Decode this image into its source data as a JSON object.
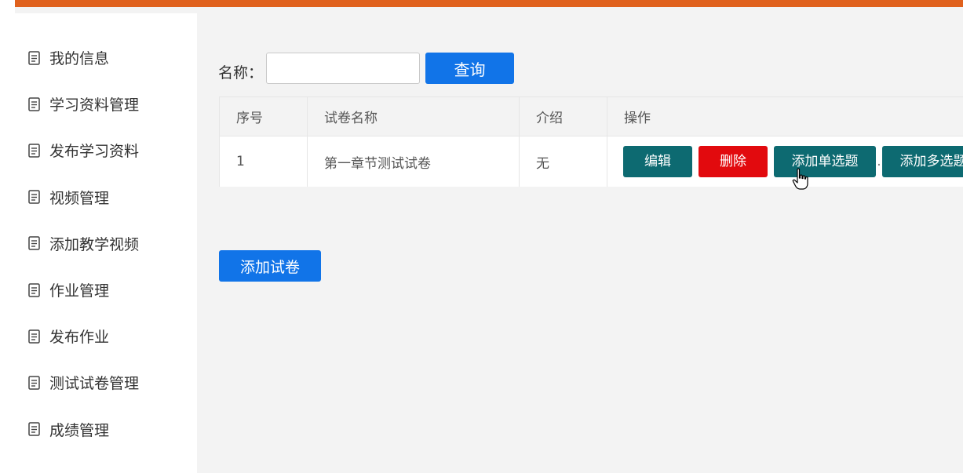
{
  "sidebar": {
    "items": [
      {
        "label": "我的信息",
        "icon": "document-icon"
      },
      {
        "label": "学习资料管理",
        "icon": "document-icon"
      },
      {
        "label": "发布学习资料",
        "icon": "document-icon"
      },
      {
        "label": "视频管理",
        "icon": "document-icon"
      },
      {
        "label": "添加教学视频",
        "icon": "document-icon"
      },
      {
        "label": "作业管理",
        "icon": "document-icon"
      },
      {
        "label": "发布作业",
        "icon": "document-icon"
      },
      {
        "label": "测试试卷管理",
        "icon": "document-icon"
      },
      {
        "label": "成绩管理",
        "icon": "document-icon"
      }
    ]
  },
  "search": {
    "label": "名称：",
    "value": "",
    "placeholder": "",
    "button_label": "查询"
  },
  "table": {
    "headers": [
      "序号",
      "试卷名称",
      "介绍",
      "操作"
    ],
    "rows": [
      {
        "index": "1",
        "name": "第一章节测试试卷",
        "intro": "无",
        "actions": [
          "编辑",
          "删除",
          "添加单选题",
          "添加多选题"
        ]
      }
    ]
  },
  "add_button": {
    "label": "添加试卷"
  },
  "colors": {
    "topbar": "#e0611d",
    "primary": "#1174e8",
    "teal": "#0d6a71",
    "danger": "#e20a0e"
  }
}
